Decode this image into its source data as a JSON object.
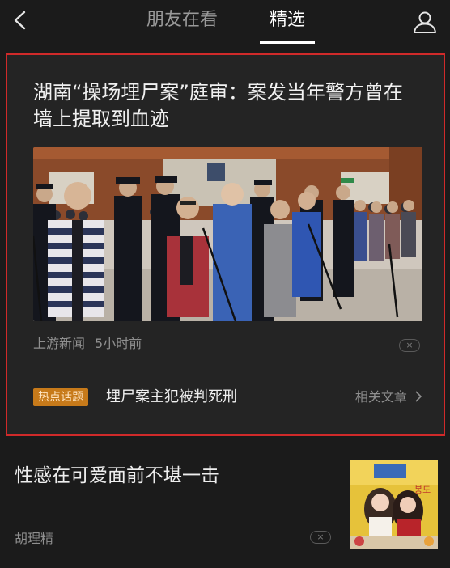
{
  "nav": {
    "tab_friends": "朋友在看",
    "tab_featured": "精选",
    "back_icon": "chevron-left-icon",
    "profile_icon": "person-icon"
  },
  "featured": {
    "title": "湖南“操场埋尸案”庭审：案发当年警方曾在墙上提取到血迹",
    "source": "上游新闻",
    "time": "5小时前",
    "dismiss": "×",
    "hot_badge": "热点话题",
    "topic": "埋尸案主犯被判死刑",
    "related": "相关文章",
    "border_color": "#d02a2a",
    "badge_color": "#c77a1a"
  },
  "article2": {
    "title": "性感在可爱面前不堪一击",
    "source": "胡理精",
    "dismiss": "×",
    "thumb_text": "봉도"
  }
}
